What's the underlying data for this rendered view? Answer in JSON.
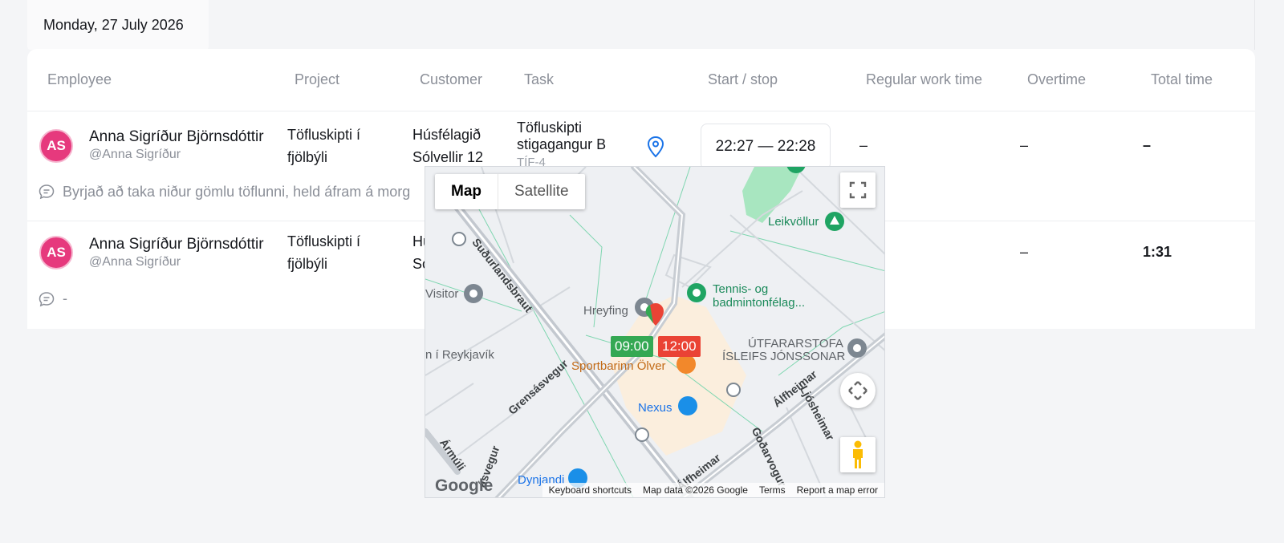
{
  "date_tab": "Monday, 27 July 2026",
  "columns": [
    "Employee",
    "Project",
    "Customer",
    "Task",
    "Start / stop",
    "Regular work time",
    "Overtime",
    "Total time"
  ],
  "rows": [
    {
      "avatar": "AS",
      "name": "Anna Sigríður Björnsdóttir",
      "handle": "@Anna Sigríður",
      "project_line1": "Töfluskipti í",
      "project_line2": "fjölbýli",
      "customer_line1": "Húsfélagið",
      "customer_line2": "Sólvellir 12",
      "task_line1": "Töfluskipti",
      "task_line2": "stigagangur B",
      "task_code": "TÍF-4",
      "start_stop": "22:27 — 22:28",
      "regular": "–",
      "overtime": "–",
      "total": "–",
      "comment": "Byrjað að taka niður gömlu töflunni, held áfram á morg"
    },
    {
      "avatar": "AS",
      "name": "Anna Sigríður Björnsdóttir",
      "handle": "@Anna Sigríður",
      "project_line1": "Töfluskipti í",
      "project_line2": "fjölbýli",
      "customer_line1": "Hú",
      "customer_line2": "Só",
      "overtime": "–",
      "total": "1:31",
      "comment": "-"
    }
  ],
  "map": {
    "type_map": "Map",
    "type_satellite": "Satellite",
    "labels": {
      "leikvollur": "Leikvöllur",
      "tennis1": "Tennis- og",
      "tennis2": "badmintonfélag...",
      "visitor": "Visitor",
      "hreyfing": "Hreyfing",
      "reykjavik": "n í Reykjavík",
      "utfarar1": "ÚTFARARSTOFA",
      "utfarar2": "ÍSLEIFS JÓNSSONAR",
      "sportbarinn": "Sportbarinn Ölver",
      "nexus": "Nexus",
      "dynjandi": "Dynjandi"
    },
    "streets": {
      "sudurlandsbraut": "Suðurlandsbraut",
      "grensasvegur": "Grensásvegur",
      "alfheimar": "Álfheimar",
      "alfheimar2": "Álfheimar",
      "ljosheimar": "Ljósheimar",
      "godarvogur": "Goðarvogur",
      "armuli": "Ármúli",
      "grensasvegur2": "ásvegur"
    },
    "time_start": "09:00",
    "time_end": "12:00",
    "google": "Google",
    "attribution": {
      "shortcuts": "Keyboard shortcuts",
      "data": "Map data ©2026 Google",
      "terms": "Terms",
      "report": "Report a map error"
    },
    "colors": {
      "start_tag": "#34a853",
      "end_tag": "#ea4335",
      "park": "#a8e6c0",
      "area": "#fbeedd"
    }
  }
}
